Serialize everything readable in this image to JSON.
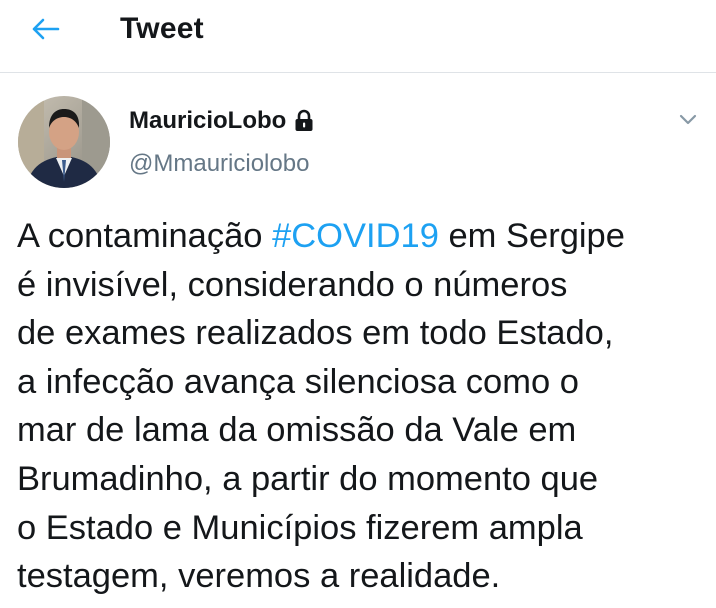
{
  "header": {
    "back_icon": "arrow-left-icon",
    "title": "Tweet"
  },
  "author": {
    "avatar_icon": "profile-photo",
    "display_name": "MauricioLobo",
    "protected_icon": "lock-icon",
    "handle": "@Mmauriciolobo",
    "menu_icon": "chevron-down-icon"
  },
  "tweet": {
    "hashtag": "#COVID19",
    "lines": [
      {
        "before": "A contaminação ",
        "after": " em Sergipe"
      },
      "é invisível, considerando o números",
      "de exames realizados em todo Estado,",
      "a infecção avança silenciosa como o",
      "mar de lama da omissão da Vale em",
      "Brumadinho, a partir do momento que",
      "o Estado e Municípios fizerem ampla",
      "testagem, veremos a realidade."
    ]
  },
  "colors": {
    "accent": "#1da1f2",
    "text": "#14171a",
    "secondary_text": "#657786",
    "divider": "#dfe3e7"
  }
}
